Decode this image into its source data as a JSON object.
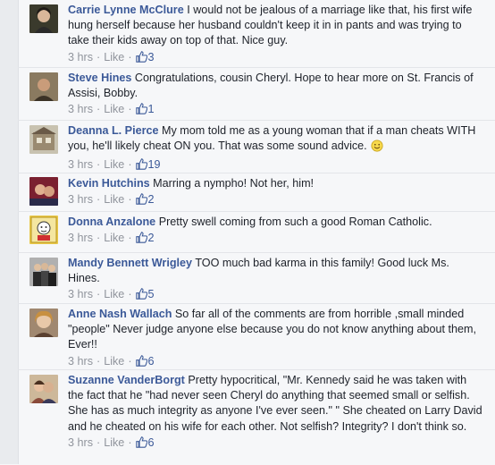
{
  "comments": [
    {
      "author": "Carrie Lynne McClure",
      "text": "I would not be jealous of a marriage like that, his first wife hung herself because her husband couldn't keep it in in pants and was trying to take their kids away on top of that. Nice guy.",
      "time": "3 hrs",
      "like_label": "Like",
      "likes": "3",
      "avatar_color": "#5a4a3a"
    },
    {
      "author": "Steve Hines",
      "text": "Congratulations, cousin Cheryl. Hope to hear more on St. Francis of Assisi, Bobby.",
      "time": "3 hrs",
      "like_label": "Like",
      "likes": "1",
      "avatar_color": "#6b5a48"
    },
    {
      "author": "Deanna L. Pierce",
      "text": "My mom told me as a young woman that if a man cheats WITH you, he'll likely cheat ON you. That was some sound advice.",
      "emoticon": "smiley-icon",
      "time": "3 hrs",
      "like_label": "Like",
      "likes": "19",
      "avatar_color": "#8a7a62"
    },
    {
      "author": "Kevin Hutchins",
      "text": "Marring a nympho! Not her, him!",
      "time": "3 hrs",
      "like_label": "Like",
      "likes": "2",
      "avatar_color": "#a03a3a"
    },
    {
      "author": "Donna Anzalone",
      "text": "Pretty swell coming from such a good Roman Catholic.",
      "time": "3 hrs",
      "like_label": "Like",
      "likes": "2",
      "avatar_color": "#c9b23a"
    },
    {
      "author": "Mandy Bennett Wrigley",
      "text": "TOO much bad karma in this family! Good luck Ms. Hines.",
      "time": "3 hrs",
      "like_label": "Like",
      "likes": "5",
      "avatar_color": "#4a4a4a"
    },
    {
      "author": "Anne Nash Wallach",
      "text": "So far all of the comments are from horrible ,small minded \"people\" Never judge anyone else because you do not know anything about them, Ever!!",
      "time": "3 hrs",
      "like_label": "Like",
      "likes": "6",
      "avatar_color": "#b08a5a"
    },
    {
      "author": "Suzanne VanderBorgt",
      "text": "Pretty hypocritical, \"Mr. Kennedy said he was taken with the fact that he \"had never seen Cheryl do anything that seemed small or selfish. She has as much integrity as anyone I've ever seen.\" \" She cheated on Larry David and he cheated on his wife for each other. Not selfish? Integrity? I don't think so.",
      "time": "3 hrs",
      "like_label": "Like",
      "likes": "6",
      "avatar_color": "#7a6450"
    }
  ],
  "colors": {
    "link": "#3b5998",
    "meta": "#90949c",
    "text": "#1d2129",
    "background": "#f6f7f9"
  },
  "icons": {
    "like_count": "thumbs-up-icon",
    "emoticon": "smiley-icon"
  }
}
